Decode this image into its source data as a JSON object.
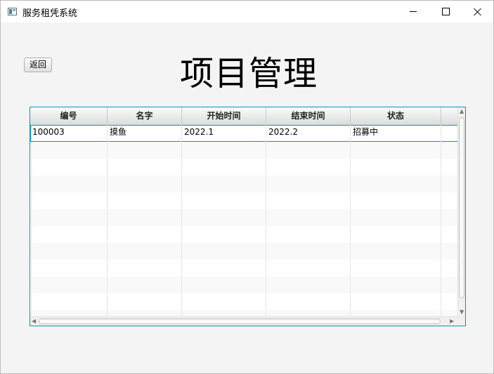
{
  "window": {
    "title": "服务租凭系统"
  },
  "toolbar": {
    "back_label": "返回"
  },
  "page": {
    "title": "项目管理"
  },
  "table": {
    "columns": [
      "编号",
      "名字",
      "开始时间",
      "结束时间",
      "状态"
    ],
    "rows": [
      [
        "100003",
        "摸鱼",
        "2022.1",
        "2022.2",
        "招募中"
      ]
    ]
  }
}
